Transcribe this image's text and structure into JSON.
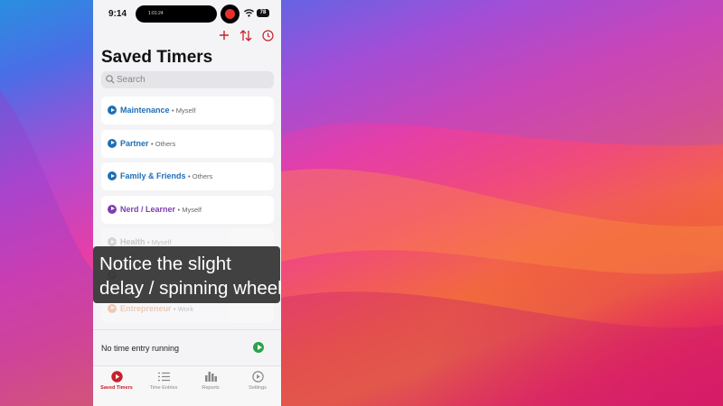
{
  "status": {
    "time": "9:14",
    "island_text": "1:01:24",
    "battery": "78"
  },
  "page": {
    "title": "Saved Timers"
  },
  "search": {
    "placeholder": "Search"
  },
  "timers": [
    {
      "name": "Maintenance",
      "owner": "• Myself",
      "color": "#1f6fb5"
    },
    {
      "name": "Partner",
      "owner": "• Others",
      "color": "#1f6fb5"
    },
    {
      "name": "Family & Friends",
      "owner": "• Others",
      "color": "#1f6fb5"
    },
    {
      "name": "Nerd / Learner",
      "owner": "• Myself",
      "color": "#7d3fb0"
    },
    {
      "name": "Health",
      "owner": "• Myself",
      "color": "#9a9a9a"
    },
    {
      "name": "",
      "owner": "",
      "color": "#9a9a9a"
    },
    {
      "name": "Entrepreneur",
      "owner": "• Work",
      "color": "#e07a3a"
    }
  ],
  "footer": {
    "status_text": "No time entry running"
  },
  "tabs": [
    {
      "label": "Saved Timers",
      "icon": "play-circle-icon"
    },
    {
      "label": "Time Entries",
      "icon": "list-icon"
    },
    {
      "label": "Reports",
      "icon": "bar-chart-icon"
    },
    {
      "label": "Settings",
      "icon": "gear-icon"
    }
  ],
  "caption": {
    "line1": "Notice the slight",
    "line2": "delay / spinning wheel"
  },
  "colors": {
    "accent_red": "#c8202a",
    "play_green": "#2aa14b"
  }
}
